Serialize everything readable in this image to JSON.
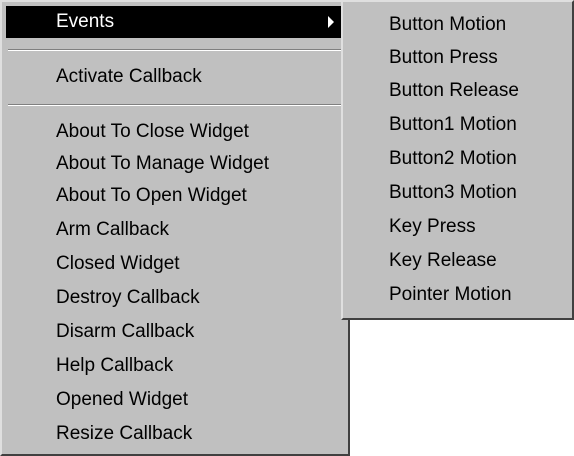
{
  "main_menu": {
    "selected_item": "Events",
    "top_item": "Events",
    "activate_item": "Activate Callback",
    "items": [
      "About To Close Widget",
      "About To Manage Widget",
      "About To Open Widget",
      "Arm Callback",
      "Closed Widget",
      "Destroy Callback",
      "Disarm Callback",
      "Help Callback",
      "Opened Widget",
      "Resize Callback"
    ]
  },
  "submenu": {
    "items": [
      "Button Motion",
      "Button Press",
      "Button Release",
      "Button1 Motion",
      "Button2 Motion",
      "Button3 Motion",
      "Key Press",
      "Key Release",
      "Pointer Motion"
    ]
  },
  "colors": {
    "menu_bg": "#c0c0c0",
    "highlight_bg": "#000000",
    "highlight_fg": "#ffffff"
  },
  "icons": {
    "submenu_arrow": "triangle-right-icon"
  }
}
